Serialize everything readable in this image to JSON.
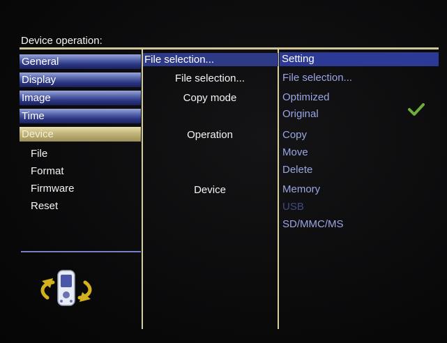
{
  "title": "Device operation:",
  "menu": [
    {
      "label": "General"
    },
    {
      "label": "Display"
    },
    {
      "label": "Image"
    },
    {
      "label": "Time"
    },
    {
      "label": "Device"
    }
  ],
  "submenu": [
    {
      "label": "File"
    },
    {
      "label": "Format"
    },
    {
      "label": "Firmware"
    },
    {
      "label": "Reset"
    }
  ],
  "middle": {
    "header": "File selection...",
    "labels": [
      "File selection...",
      "Copy mode",
      "Operation",
      "Device"
    ]
  },
  "right": {
    "header": "Setting",
    "options": [
      "File selection...",
      "Optimized",
      "Original",
      "Copy",
      "Move",
      "Delete",
      "Memory",
      "USB",
      "SD/MMC/MS"
    ]
  },
  "colors": {
    "accent": "#2d3a95",
    "selected": "#c2b47a",
    "option_text": "#9aa6e2",
    "check": "#6fae3b"
  },
  "icons": {
    "device": "rotate-device-icon",
    "check": "check-icon"
  }
}
